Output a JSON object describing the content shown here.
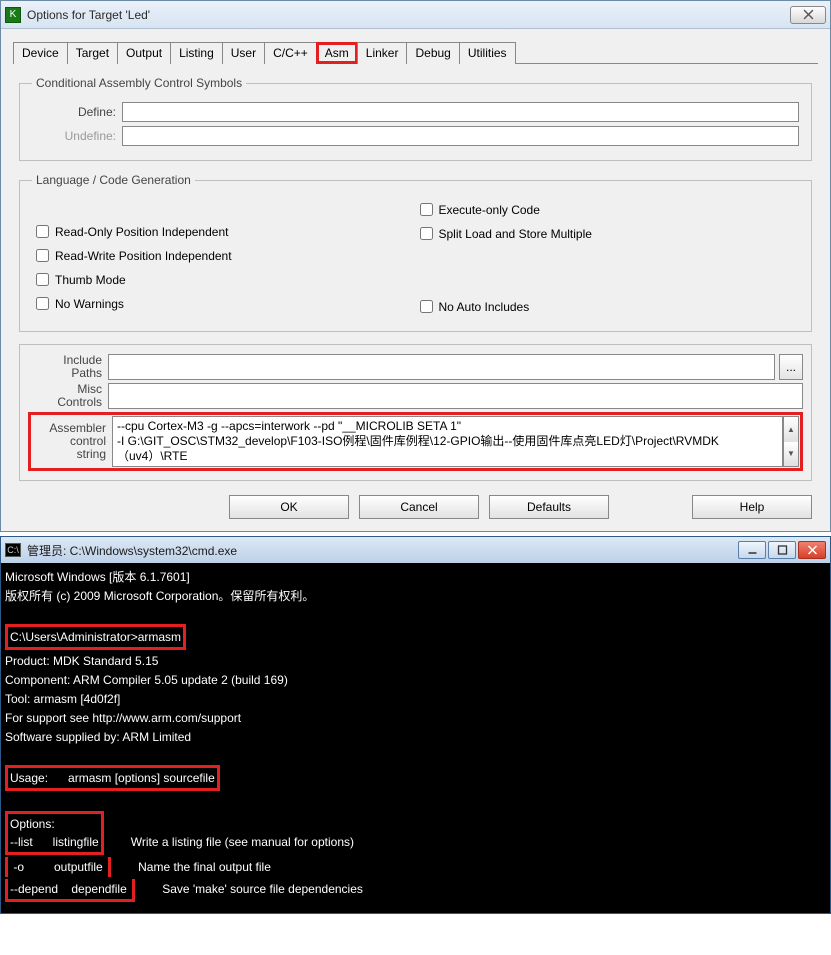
{
  "dialog": {
    "title": "Options for Target 'Led'",
    "tabs": [
      "Device",
      "Target",
      "Output",
      "Listing",
      "User",
      "C/C++",
      "Asm",
      "Linker",
      "Debug",
      "Utilities"
    ],
    "active_tab": "Asm",
    "group_cond": {
      "legend": "Conditional Assembly Control Symbols",
      "define_label": "Define:",
      "define_value": "",
      "undefine_label": "Undefine:",
      "undefine_value": ""
    },
    "group_lang": {
      "legend": "Language / Code Generation",
      "left": [
        "Read-Only Position Independent",
        "Read-Write Position Independent",
        "Thumb Mode",
        "No Warnings"
      ],
      "right": [
        "Execute-only Code",
        "Split Load and Store Multiple",
        "No Auto Includes"
      ]
    },
    "group_paths": {
      "include_label": "Include\nPaths",
      "include_value": "",
      "misc_label": "Misc\nControls",
      "misc_value": "",
      "acs_label": "Assembler\ncontrol\nstring",
      "acs_value": "--cpu Cortex-M3 -g --apcs=interwork --pd \"__MICROLIB SETA 1\"\n-I G:\\GIT_OSC\\STM32_develop\\F103-ISO例程\\固件库例程\\12-GPIO输出--使用固件库点亮LED灯\\Project\\RVMDK（uv4）\\RTE"
    },
    "buttons": {
      "ok": "OK",
      "cancel": "Cancel",
      "defaults": "Defaults",
      "help": "Help"
    }
  },
  "console": {
    "title": "管理员: C:\\Windows\\system32\\cmd.exe",
    "icon_text": "C:\\",
    "line1": "Microsoft Windows [版本 6.1.7601]",
    "line2": "版权所有 (c) 2009 Microsoft Corporation。保留所有权利。",
    "prompt_line": "C:\\Users\\Administrator>armasm",
    "out1": "Product: MDK Standard 5.15",
    "out2": "Component: ARM Compiler 5.05 update 2 (build 169)",
    "out3": "Tool: armasm [4d0f2f]",
    "out4": "For support see http://www.arm.com/support",
    "out5": "Software supplied by: ARM Limited",
    "usage": "Usage:      armasm [options] sourcefile",
    "opts_head": "Options:",
    "opts1": "--list      listingfile",
    "opts1d": "Write a listing file (see manual for options)",
    "opts2": " -o         outputfile ",
    "opts2d": "Name the final output file",
    "opts3": "--depend    dependfile ",
    "opts3d": "Save 'make' source file dependencies"
  }
}
